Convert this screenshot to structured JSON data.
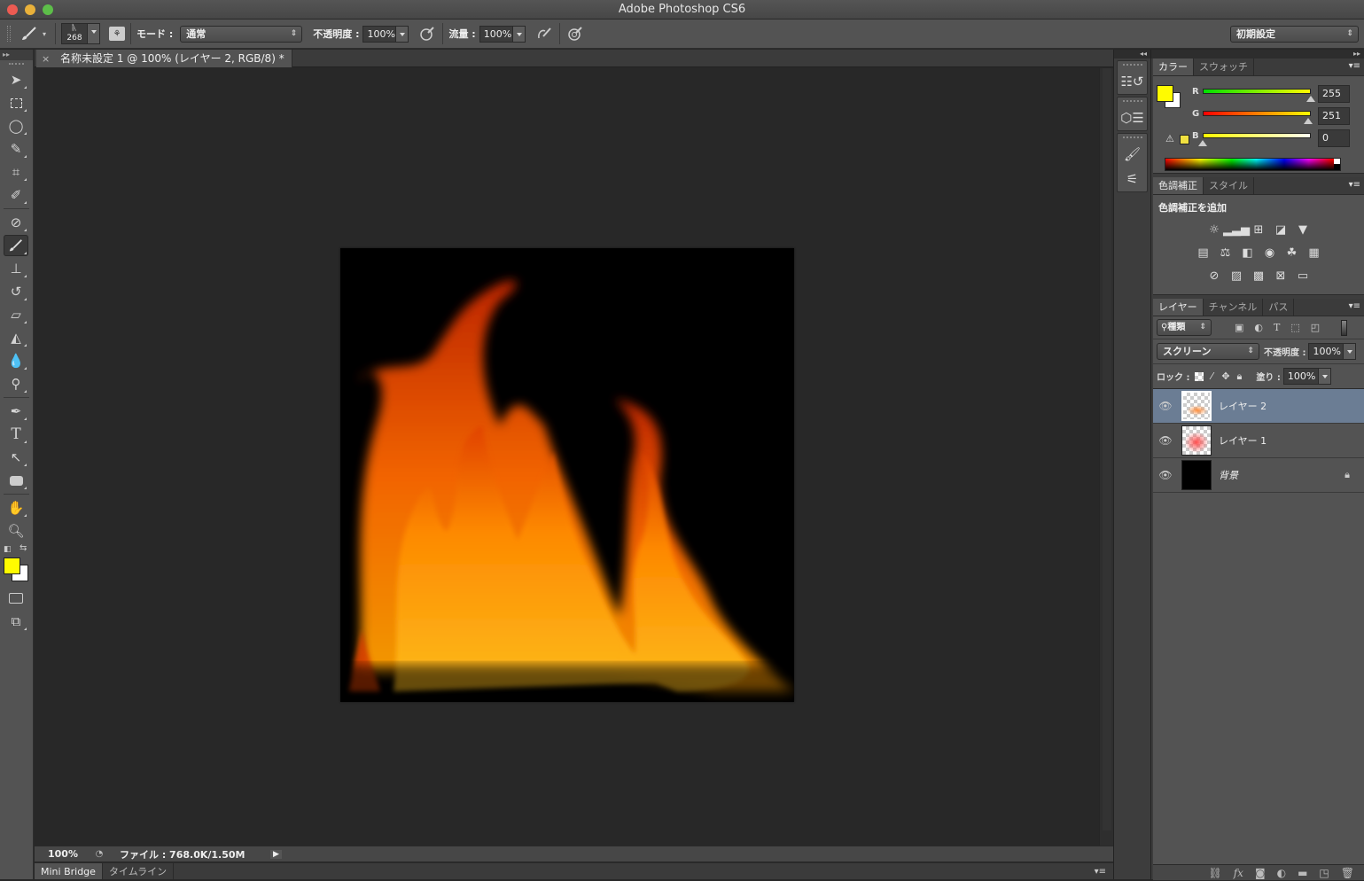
{
  "window": {
    "title": "Adobe Photoshop CS6",
    "buttons": {
      "close": "#ed5b52",
      "minimize": "#e9b13a",
      "zoom": "#5dbe49"
    }
  },
  "options_bar": {
    "tool_icon": "brush-icon",
    "brush_size": "268",
    "mode_label": "モード :",
    "mode_value": "通常",
    "opacity_label": "不透明度 :",
    "opacity_value": "100%",
    "flow_label": "流量 :",
    "flow_value": "100%",
    "workspace": "初期設定"
  },
  "document": {
    "tab_title": "名称未設定 1 @ 100% (レイヤー 2, RGB/8) *",
    "close_glyph": "×"
  },
  "status_bar": {
    "zoom": "100%",
    "info": "ファイル : 768.0K/1.50M"
  },
  "bottom_tabs": [
    {
      "label": "Mini Bridge",
      "active": true
    },
    {
      "label": "タイムライン",
      "active": false
    }
  ],
  "tools": [
    "move-tool",
    "marquee-tool",
    "lasso-tool",
    "quick-selection-tool",
    "crop-tool",
    "eyedropper-tool",
    "healing-brush-tool",
    "brush-tool",
    "clone-stamp-tool",
    "history-brush-tool",
    "eraser-tool",
    "paint-bucket-tool",
    "blur-tool",
    "dodge-tool",
    "pen-tool",
    "type-tool",
    "path-selection-tool",
    "rectangle-tool",
    "hand-tool",
    "zoom-tool"
  ],
  "colors": {
    "foreground": "#fffb00",
    "background": "#ffffff",
    "selection": "#6b7d94"
  },
  "color_panel": {
    "tabs": [
      {
        "label": "カラー",
        "active": true
      },
      {
        "label": "スウォッチ",
        "active": false
      }
    ],
    "channels": [
      {
        "label": "R",
        "value": "255"
      },
      {
        "label": "G",
        "value": "251"
      },
      {
        "label": "B",
        "value": "0"
      }
    ]
  },
  "adjustments_panel": {
    "tabs": [
      {
        "label": "色調補正",
        "active": true
      },
      {
        "label": "スタイル",
        "active": false
      }
    ],
    "heading": "色調補正を追加",
    "icons": [
      [
        "brightness-contrast-icon",
        "levels-icon",
        "curves-icon",
        "exposure-icon",
        "vibrance-icon"
      ],
      [
        "hue-saturation-icon",
        "color-balance-icon",
        "black-white-icon",
        "photo-filter-icon",
        "channel-mixer-icon",
        "color-lookup-icon"
      ],
      [
        "invert-icon",
        "posterize-icon",
        "threshold-icon",
        "selective-color-icon",
        "gradient-map-icon"
      ]
    ]
  },
  "layers_panel": {
    "tabs": [
      {
        "label": "レイヤー",
        "active": true
      },
      {
        "label": "チャンネル",
        "active": false
      },
      {
        "label": "パス",
        "active": false
      }
    ],
    "filter_kind": "種類",
    "blend_mode": "スクリーン",
    "opacity_label": "不透明度 :",
    "opacity_value": "100%",
    "lock_label": "ロック :",
    "fill_label": "塗り :",
    "fill_value": "100%",
    "layers": [
      {
        "name": "レイヤー 2",
        "selected": true,
        "locked": false,
        "thumb": "transparent-fire-orange"
      },
      {
        "name": "レイヤー 1",
        "selected": false,
        "locked": false,
        "thumb": "transparent-fire-red"
      },
      {
        "name": "背景",
        "selected": false,
        "locked": true,
        "thumb": "black"
      }
    ]
  }
}
